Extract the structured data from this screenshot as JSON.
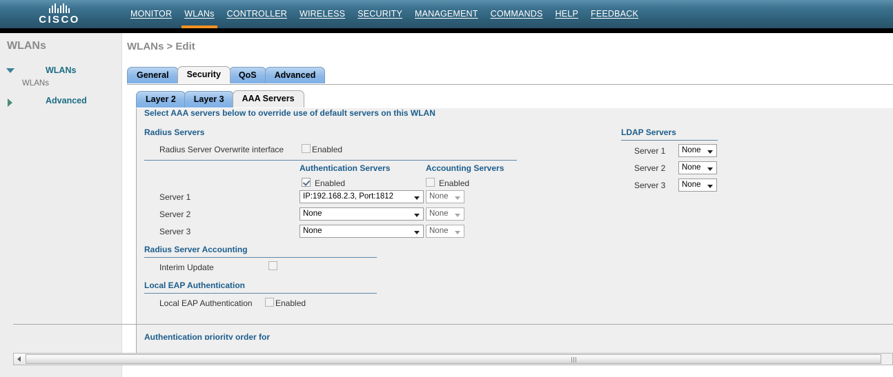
{
  "header": {
    "logo_word": "CISCO",
    "nav": [
      {
        "label": "MONITOR",
        "accel": "M",
        "active": false
      },
      {
        "label": "WLANs",
        "accel": "W",
        "active": true
      },
      {
        "label": "CONTROLLER",
        "accel": "C",
        "active": false
      },
      {
        "label": "WIRELESS",
        "accel": "I",
        "active": false
      },
      {
        "label": "SECURITY",
        "accel": "S",
        "active": false
      },
      {
        "label": "MANAGEMENT",
        "accel": "A",
        "active": false
      },
      {
        "label": "COMMANDS",
        "accel": "O",
        "active": false
      },
      {
        "label": "HELP",
        "accel": "L",
        "active": false
      },
      {
        "label": "FEEDBACK",
        "accel": "F",
        "active": false
      }
    ]
  },
  "sidebar": {
    "title": "WLANs",
    "nodes": [
      {
        "label": "WLANs",
        "expanded": true,
        "child": "WLANs"
      },
      {
        "label": "Advanced",
        "expanded": false
      }
    ]
  },
  "main": {
    "breadcrumb": "WLANs > Edit",
    "tabs": [
      {
        "label": "General",
        "active": false
      },
      {
        "label": "Security",
        "active": true
      },
      {
        "label": "QoS",
        "active": false
      },
      {
        "label": "Advanced",
        "active": false
      }
    ],
    "subtabs": [
      {
        "label": "Layer 2",
        "active": false
      },
      {
        "label": "Layer 3",
        "active": false
      },
      {
        "label": "AAA Servers",
        "active": true
      }
    ]
  },
  "panel": {
    "intro": "Select AAA servers below to override use of default servers on this WLAN",
    "radius_servers": {
      "title": "Radius Servers",
      "overwrite_label": "Radius Server Overwrite interface",
      "overwrite_enabled_text": "Enabled",
      "overwrite_checked": false,
      "auth_column": "Authentication Servers",
      "acct_column": "Accounting Servers",
      "auth_enabled_text": "Enabled",
      "auth_enabled_checked": true,
      "acct_enabled_text": "Enabled",
      "acct_enabled_checked": false,
      "rows": [
        {
          "label": "Server 1",
          "auth_value": "IP:192.168.2.3, Port:1812",
          "acct_value": "None"
        },
        {
          "label": "Server 2",
          "auth_value": "None",
          "acct_value": "None"
        },
        {
          "label": "Server 3",
          "auth_value": "None",
          "acct_value": "None"
        }
      ]
    },
    "radius_accounting": {
      "title": "Radius Server Accounting",
      "interim_label": "Interim Update",
      "interim_checked": false
    },
    "local_eap": {
      "title": "Local EAP Authentication",
      "label": "Local EAP Authentication",
      "enabled_text": "Enabled",
      "checked": false
    },
    "clipped_section": "Authentication priority order for",
    "ldap": {
      "title": "LDAP Servers",
      "rows": [
        {
          "label": "Server 1",
          "value": "None"
        },
        {
          "label": "Server 2",
          "value": "None"
        },
        {
          "label": "Server 3",
          "value": "None"
        }
      ]
    }
  },
  "colors": {
    "header_blue": "#3d7391",
    "accent_orange": "#f59220",
    "section_blue": "#1c5d8c",
    "tab_blue": "#8cb8e8"
  }
}
